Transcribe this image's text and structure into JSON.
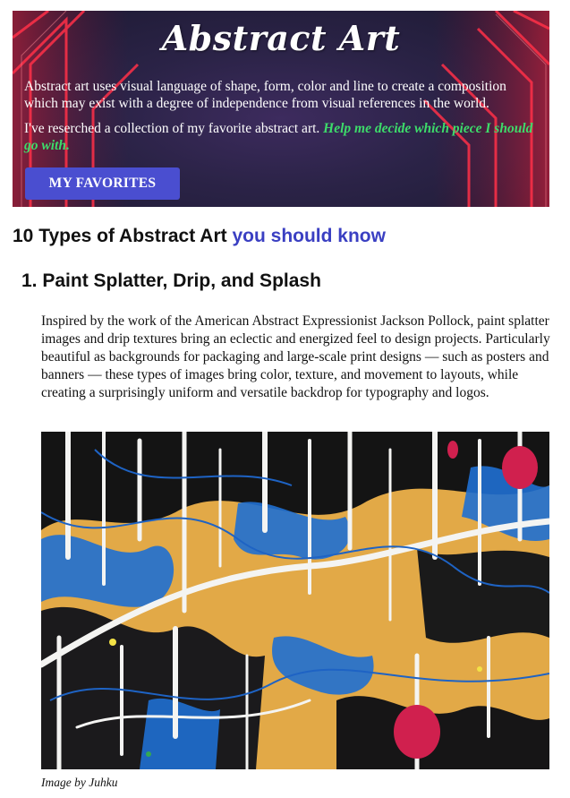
{
  "hero": {
    "title": "Abstract Art",
    "intro": "Abstract art uses visual language of shape, form, color and line to create a composition which may exist with a degree of independence from visual references in the world.",
    "research": "I've reserched a collection of my favorite abstract art.",
    "cta_text": "Help me decide which piece I should go with.",
    "button_label": "MY FAVORITES"
  },
  "section": {
    "heading_main": "10 Types of Abstract Art",
    "heading_accent": "you should know"
  },
  "item1": {
    "heading": "1. Paint Splatter, Drip, and Splash",
    "body": "Inspired by the work of the American Abstract Expressionist Jackson Pollock, paint splatter images and drip textures bring an eclectic and energized feel to design projects. Particularly beautiful as backgrounds for packaging and large-scale print designs — such as posters and banners — these types of images bring color, texture, and movement to layouts, while creating a surprisingly uniform and versatile backdrop for typography and logos.",
    "caption": "Image by Juhku"
  },
  "colors": {
    "button": "#4a4ed0",
    "accent_heading": "#3a3fc2",
    "cta_green": "#3ddc6a"
  }
}
